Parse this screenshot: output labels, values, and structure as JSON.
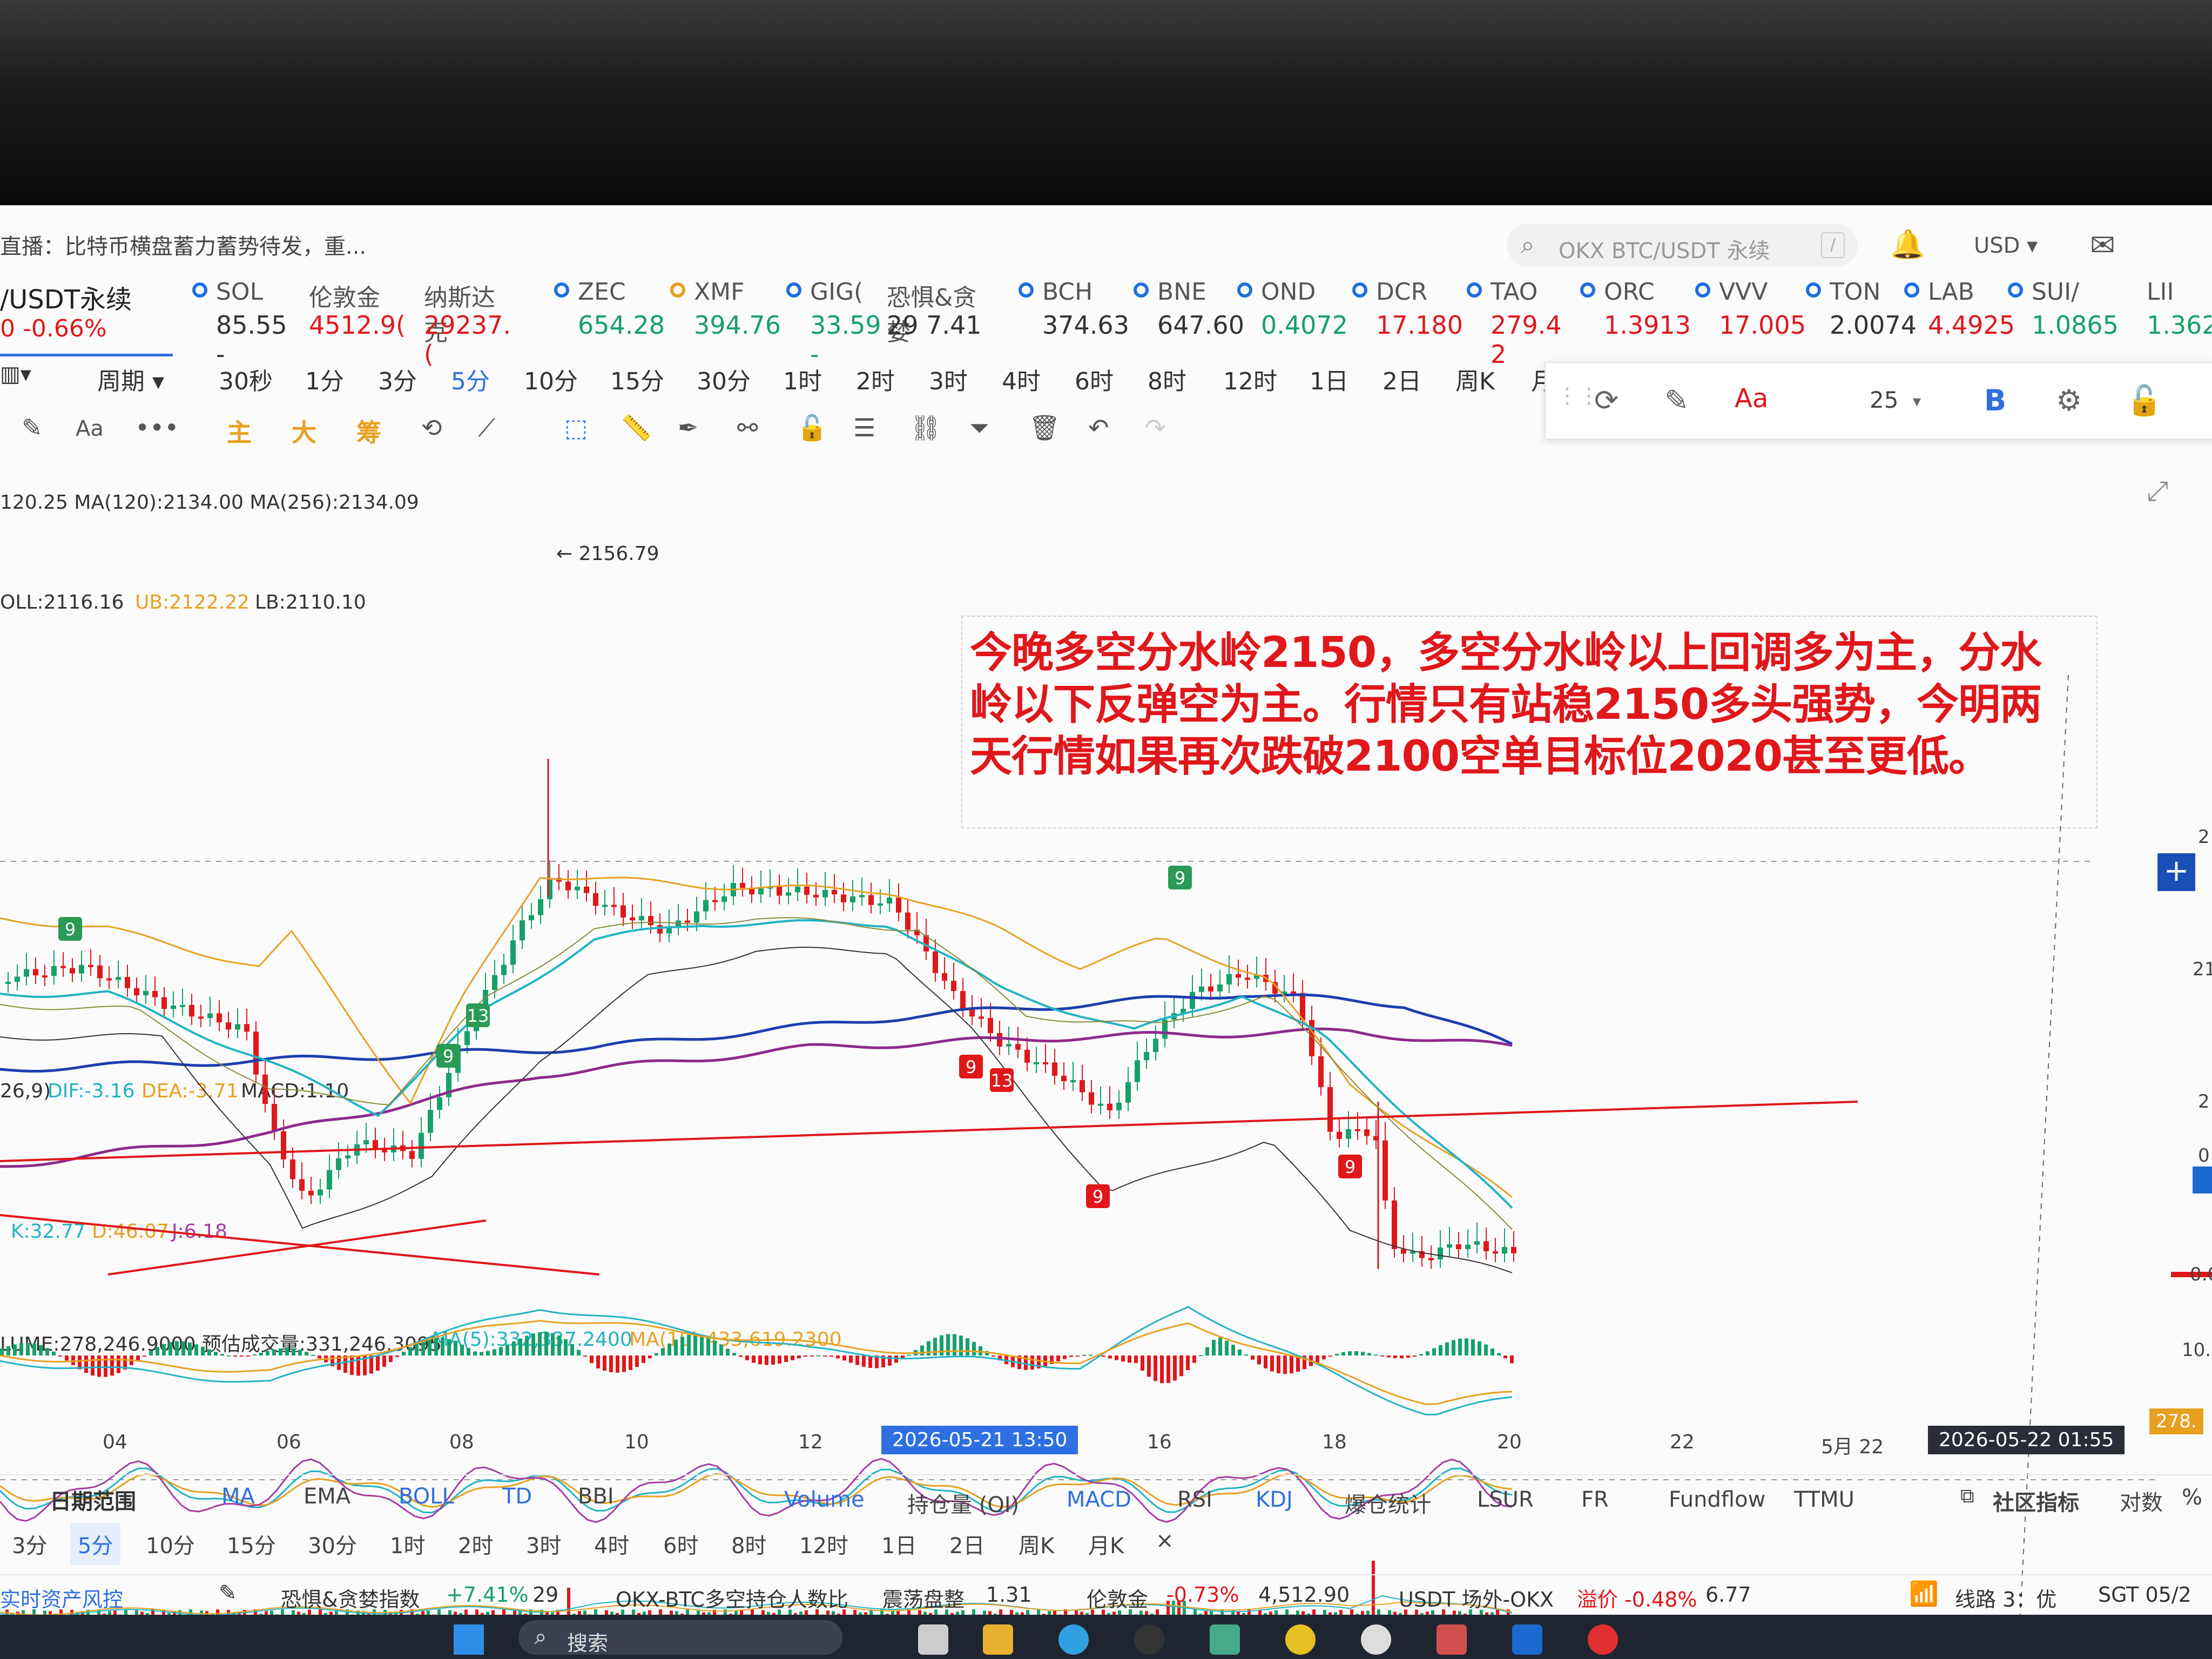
{
  "header": {
    "live_text": "直播：比特币横盘蓄力蓄势待发，重...",
    "search_placeholder": "OKX BTC/USDT 永续",
    "search_shortcut": "/",
    "currency": "USD ▾"
  },
  "tickers": [
    {
      "name": "/USDT永续",
      "price": "0 -0.66%",
      "color": "#e0171b"
    },
    {
      "name": "SOL",
      "price": "85.55 -",
      "color": "#333333"
    },
    {
      "name": "伦敦金",
      "price": "4512.9(",
      "color": "#e0171b"
    },
    {
      "name": "纳斯达克",
      "price": "29237.(",
      "color": "#e0171b"
    },
    {
      "name": "ZEC",
      "price": "654.28",
      "color": "#16a06a"
    },
    {
      "name": "XMF",
      "price": "394.76",
      "color": "#16a06a"
    },
    {
      "name": "GIG(",
      "price": "33.59 -",
      "color": "#16a06a"
    },
    {
      "name": "恐惧&贪婪",
      "price": "29 7.41",
      "color": "#333333"
    },
    {
      "name": "BCH",
      "price": "374.63",
      "color": "#333333"
    },
    {
      "name": "BNE",
      "price": "647.60",
      "color": "#333333"
    },
    {
      "name": "OND",
      "price": "0.4072",
      "color": "#16a06a"
    },
    {
      "name": "DCR",
      "price": "17.180",
      "color": "#e0171b"
    },
    {
      "name": "TAO",
      "price": "279.4 2",
      "color": "#e0171b"
    },
    {
      "name": "ORC",
      "price": "1.3913",
      "color": "#e0171b"
    },
    {
      "name": "VVV",
      "price": "17.005",
      "color": "#e0171b"
    },
    {
      "name": "TON",
      "price": "2.0074",
      "color": "#333333"
    },
    {
      "name": "LAB",
      "price": "4.4925",
      "color": "#e0171b"
    },
    {
      "name": "SUI/",
      "price": "1.0865",
      "color": "#16a06a"
    },
    {
      "name": "LII",
      "price": "1.362(",
      "color": "#16a06a"
    }
  ],
  "timeframes": [
    "周期 ▾",
    "30秒",
    "1分",
    "3分",
    "5分",
    "10分",
    "15分",
    "30分",
    "1时",
    "2时",
    "3时",
    "4时",
    "6时",
    "8时",
    "12时",
    "1日",
    "2日",
    "周K",
    "月"
  ],
  "toolbar_labels": [
    "主",
    "大",
    "筹"
  ],
  "toolbar_aa": "Aa",
  "font_size_value": "25",
  "indicators": {
    "ma": "120.25  MA(120):2134.00  MA(256):2134.09",
    "peak_label": "← 2156.79",
    "boll_prefix": "OLL:2116.16",
    "boll_ub": "UB:2122.22",
    "boll_lb": "LB:2110.10",
    "macd_prefix": "26,9)",
    "macd_dif": "DIF:-3.16",
    "macd_dea": "DEA:-3.71",
    "macd_val": "MACD:1.10",
    "kdj_k": "K:32.77",
    "kdj_d": "D:46.07",
    "kdj_j": "J:6.18",
    "vol": "LUME:278,246.9000  预估成交量:331,246.3095",
    "vol_ma5": "MA(5):332,337.2400",
    "vol_ma10": "MA(10):433,619.2300"
  },
  "annotation": {
    "line1": "今晚多空分水岭2150，多空分水岭以上回调多为主，分水",
    "line2": "岭以下反弹空为主。行情只有站稳2150多头强势，今明两",
    "line3": "天行情如果再次跌破2100空单目标位2020甚至更低。"
  },
  "markers": [
    "9",
    "13",
    "9",
    "9",
    "13",
    "9",
    "9",
    "9"
  ],
  "x_axis": [
    "04",
    "06",
    "08",
    "10",
    "12",
    "16",
    "18",
    "20",
    "22",
    "5月 22"
  ],
  "x_cursor": "2026-05-21 13:50",
  "x_cursor_right": "2026-05-22 01:55",
  "right_axis": [
    "2",
    "2",
    "21",
    "0",
    "0.0",
    "10.0",
    "278."
  ],
  "bottom_tabs": [
    "日期范围",
    "MA",
    "EMA",
    "BOLL",
    "TD",
    "BBI",
    "Volume",
    "持仓量 (OI)",
    "MACD",
    "RSI",
    "KDJ",
    "爆仓统计",
    "LSUR",
    "FR",
    "Fundflow",
    "TTMU"
  ],
  "bottom_tabs_right": [
    "社区指标",
    "对数",
    "%"
  ],
  "bottom_timeframes": [
    "3分",
    "5分",
    "10分",
    "15分",
    "30分",
    "1时",
    "2时",
    "3时",
    "4时",
    "6时",
    "8时",
    "12时",
    "1日",
    "2日",
    "周K",
    "月K",
    "×"
  ],
  "status": {
    "risk": "实时资产风控",
    "fg_label": "恐惧&贪婪指数",
    "fg_change": "+7.41%",
    "fg_value": "29",
    "ls_label": "OKX-BTC多空持仓人数比",
    "ls_state": "震荡盘整",
    "ls_value": "1.31",
    "gold_label": "伦敦金",
    "gold_change": "-0.73%",
    "gold_value": "4,512.90",
    "usdt_label": "USDT 场外-OKX",
    "usdt_premium": "溢价 -0.48%",
    "usdt_value": "6.77",
    "route": "线路 3：优",
    "clock": "SGT 05/2"
  },
  "taskbar": {
    "search": "搜索"
  },
  "colors": {
    "up": "#16a06a",
    "down": "#e0171b",
    "accent": "#2f6fe0",
    "ma_blue": "#1d3fae",
    "ma_purple": "#8e2a8c",
    "boll_orange": "#e8a020",
    "teal": "#21b3c4"
  }
}
